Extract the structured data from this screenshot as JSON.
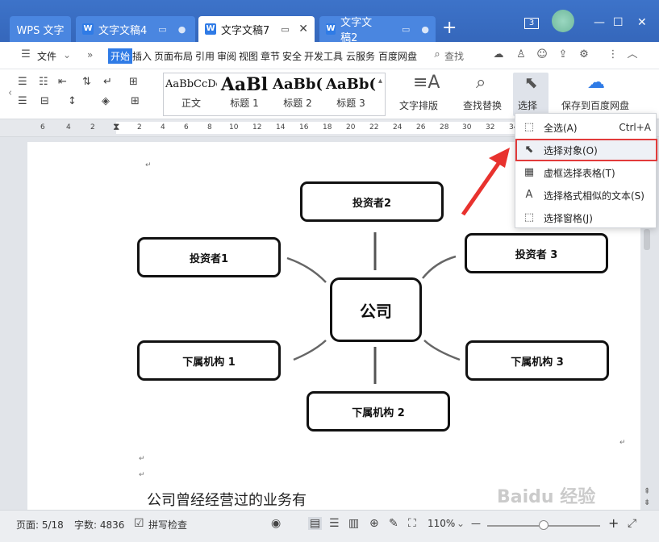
{
  "window": {
    "tabs": [
      {
        "label": "WPS 文字"
      },
      {
        "label": "文字文稿4"
      },
      {
        "label": "文字文稿7"
      },
      {
        "label": "文字文稿2"
      }
    ],
    "badge": "3"
  },
  "menu": {
    "items": [
      "文件",
      "开始",
      "插入",
      "页面布局",
      "引用",
      "审阅",
      "视图",
      "章节",
      "安全",
      "开发工具",
      "云服务",
      "百度网盘"
    ],
    "search": "查找"
  },
  "ribbon": {
    "styles": [
      {
        "preview": "AaBbCcDd",
        "caption": "正文"
      },
      {
        "preview": "AaBl",
        "caption": "标题 1"
      },
      {
        "preview": "AaBb(",
        "caption": "标题 2"
      },
      {
        "preview": "AaBb(",
        "caption": "标题 3"
      }
    ],
    "text_layout": "文字排版",
    "find_replace": "查找替换",
    "select": "选择",
    "save_baidu": "保存到百度网盘"
  },
  "ruler": [
    "6",
    "4",
    "2",
    "2",
    "4",
    "6",
    "8",
    "10",
    "12",
    "14",
    "16",
    "18",
    "20",
    "22",
    "24",
    "26",
    "28",
    "30",
    "32",
    "34"
  ],
  "select_menu": {
    "items": [
      {
        "label": "全选(A)",
        "shortcut": "Ctrl+A",
        "icon": "select-all-icon"
      },
      {
        "label": "选择对象(O)",
        "shortcut": "",
        "icon": "cursor-icon"
      },
      {
        "label": "虚框选择表格(T)",
        "shortcut": "",
        "icon": "table-select-icon"
      },
      {
        "label": "选择格式相似的文本(S)",
        "shortcut": "",
        "icon": "text-format-icon"
      },
      {
        "label": "选择窗格(J)",
        "shortcut": "",
        "icon": "selection-pane-icon"
      }
    ]
  },
  "diagram": {
    "center": "公司",
    "nodes": [
      "投资者2",
      "投资者1",
      "投资者 3",
      "下属机构 1",
      "下属机构 3",
      "下属机构 2"
    ]
  },
  "body_text": "公司曾经经营过的业务有",
  "status": {
    "page": "页面: 5/18",
    "words": "字数: 4836",
    "spell": "拼写检查",
    "zoom": "110%"
  },
  "watermark": "Baidu 经验"
}
